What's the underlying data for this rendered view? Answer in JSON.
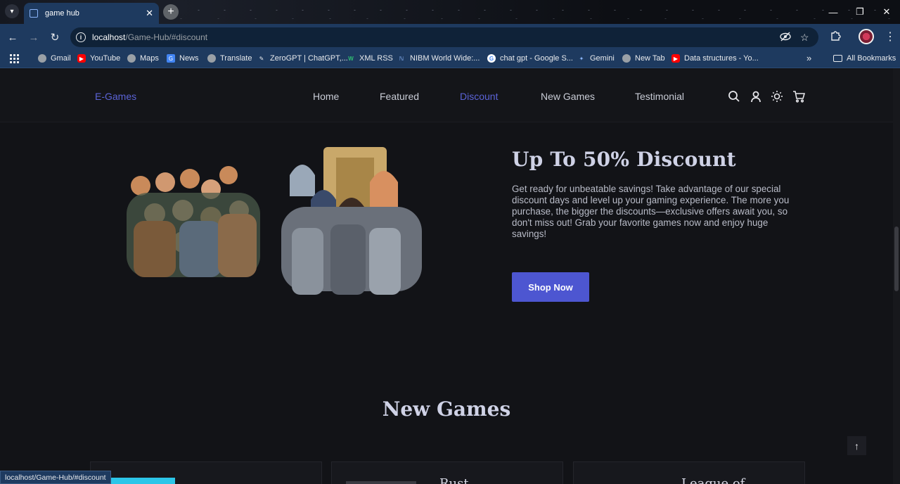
{
  "browser": {
    "tab_title": "game hub",
    "url_host": "localhost",
    "url_path": "/Game-Hub/#discount",
    "status_url": "localhost/Game-Hub/#discount",
    "bookmarks": [
      {
        "label": "Gmail",
        "icon": "globe-icon"
      },
      {
        "label": "YouTube",
        "icon": "youtube-icon"
      },
      {
        "label": "Maps",
        "icon": "globe-icon"
      },
      {
        "label": "News",
        "icon": "news-icon"
      },
      {
        "label": "Translate",
        "icon": "globe-icon"
      },
      {
        "label": "ZeroGPT | ChatGPT,...",
        "icon": "zerogpt-icon"
      },
      {
        "label": "XML RSS",
        "icon": "rss-icon"
      },
      {
        "label": "NIBM World Wide:...",
        "icon": "nibm-icon"
      },
      {
        "label": "chat gpt - Google S...",
        "icon": "google-icon"
      },
      {
        "label": "Gemini",
        "icon": "gemini-icon"
      },
      {
        "label": "New Tab",
        "icon": "globe-icon"
      },
      {
        "label": "Data structures - Yo...",
        "icon": "youtube-icon"
      }
    ],
    "all_bookmarks": "All Bookmarks",
    "overflow": "»"
  },
  "site": {
    "brand": "E-Games",
    "nav": [
      "Home",
      "Featured",
      "Discount",
      "New Games",
      "Testimonial"
    ],
    "active_nav": "Discount",
    "accent_color": "#5b63d6"
  },
  "discount": {
    "title": "Up To 50% Discount",
    "text": "Get ready for unbeatable savings! Take advantage of our special discount days and level up your gaming experience. The more you purchase, the bigger the discounts—exclusive offers await you, so don't miss out! Grab your favorite games now and enjoy huge savings!",
    "button": "Shop Now"
  },
  "new_games": {
    "title": "New Games",
    "cards": [
      "",
      "Rust",
      "League of"
    ]
  }
}
